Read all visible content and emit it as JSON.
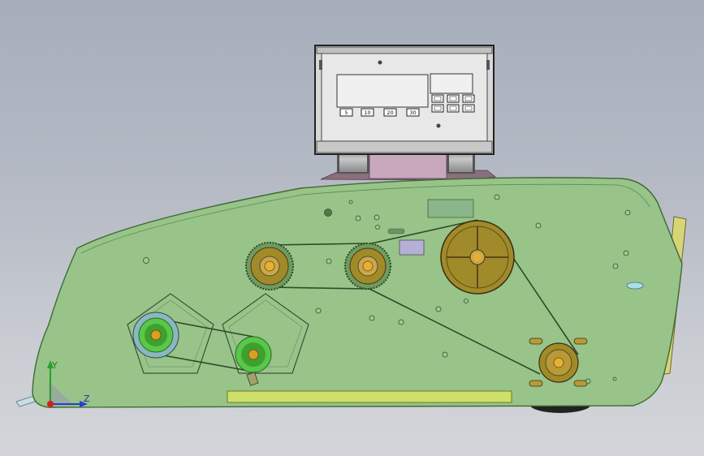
{
  "display": {
    "buttons_row_bottom": [
      "5",
      "10",
      "20",
      "30"
    ],
    "buttons_grid": [
      "",
      "",
      "",
      "",
      "",
      ""
    ]
  },
  "axes": {
    "y": "Y",
    "z": "Z"
  },
  "colors": {
    "body_fill": "#98c389",
    "body_stroke": "#3e6a33",
    "belt": "#2e4a28",
    "brass_pulley": "#a08a2a",
    "green_pulley": "#58c848",
    "lime_strip": "#cfe06a"
  }
}
